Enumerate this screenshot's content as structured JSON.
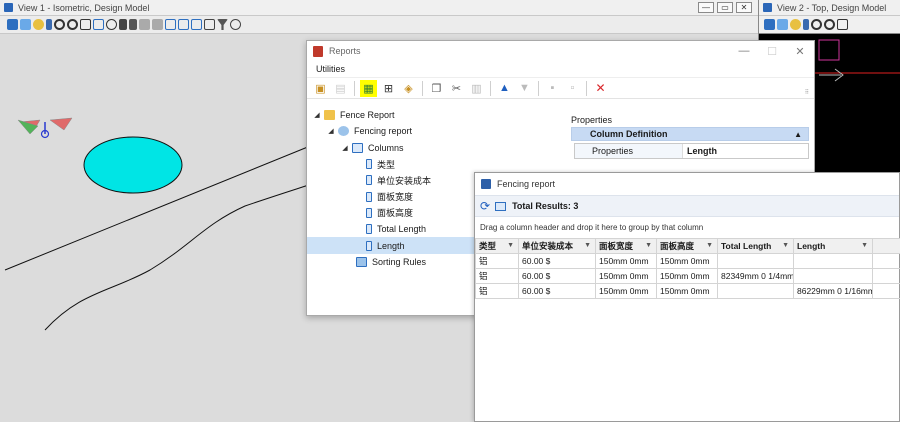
{
  "view1": {
    "title": "View 1 - Isometric, Design Model",
    "restore_label": "▭",
    "close_label": "✕",
    "minimize_label": "—"
  },
  "view2": {
    "title": "View 2 - Top, Design Model"
  },
  "reports": {
    "title": "Reports",
    "menu": [
      "Utilities"
    ],
    "tree": [
      {
        "label": "Fence Report",
        "level": 0,
        "icon": "folder-icon"
      },
      {
        "label": "Fencing report",
        "level": 1,
        "icon": "report-icon"
      },
      {
        "label": "Columns",
        "level": 2,
        "icon": "columns-icon"
      },
      {
        "label": "类型",
        "level": 3,
        "icon": "column-icon"
      },
      {
        "label": "单位安装成本",
        "level": 3,
        "icon": "column-icon"
      },
      {
        "label": "面板宽度",
        "level": 3,
        "icon": "column-icon"
      },
      {
        "label": "面板高度",
        "level": 3,
        "icon": "column-icon"
      },
      {
        "label": "Total Length",
        "level": 3,
        "icon": "column-icon"
      },
      {
        "label": "Length",
        "level": 3,
        "icon": "column-icon"
      },
      {
        "label": "Sorting Rules",
        "level": 2,
        "icon": "sorting-icon"
      }
    ],
    "properties": {
      "title": "Properties",
      "section": "Column Definition",
      "row_key": "Properties",
      "row_value": "Length"
    }
  },
  "fencing": {
    "title": "Fencing report",
    "total_results": "Total Results: 3",
    "group_hint": "Drag a column header and drop it here to group by that column",
    "columns": [
      "类型",
      "单位安装成本",
      "面板宽度",
      "面板高度",
      "Total Length",
      "Length"
    ],
    "rows": [
      [
        "铝",
        "60.00 $",
        "150mm 0mm",
        "150mm 0mm",
        "",
        ""
      ],
      [
        "铝",
        "60.00 $",
        "150mm 0mm",
        "150mm 0mm",
        "82349mm 0 1/4mm",
        ""
      ],
      [
        "铝",
        "60.00 $",
        "150mm 0mm",
        "150mm 0mm",
        "",
        "86229mm 0 1/16mm"
      ]
    ]
  },
  "colors": {
    "ellipse": "#00e5e5",
    "highlight": "#ffff00",
    "close_red": "#d9262a",
    "selection": "#cde2f7"
  }
}
